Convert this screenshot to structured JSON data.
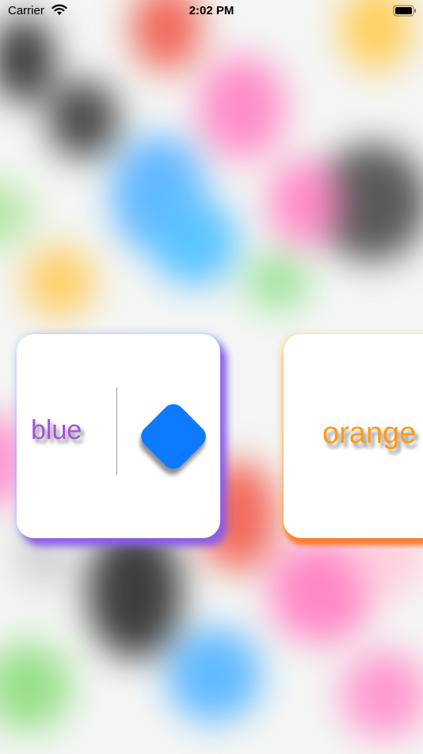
{
  "status_bar": {
    "carrier": "Carrier",
    "time": "2:02 PM",
    "icons": [
      "wifi-icon",
      "battery-icon"
    ]
  },
  "cards": [
    {
      "label": "blue",
      "label_color": "#a352e0",
      "shape": "diamond-icon",
      "shape_color": "#0a7aff",
      "glow_color": "#8c5ae6"
    },
    {
      "label": "orange",
      "label_color": "#ff9a14",
      "glow_color": "#ff7828"
    }
  ],
  "colors": {
    "background_blobs": [
      "#444444",
      "#f26b5b",
      "#ff7fc4",
      "#ffd36a",
      "#5fb8ff",
      "#9be08a"
    ]
  }
}
